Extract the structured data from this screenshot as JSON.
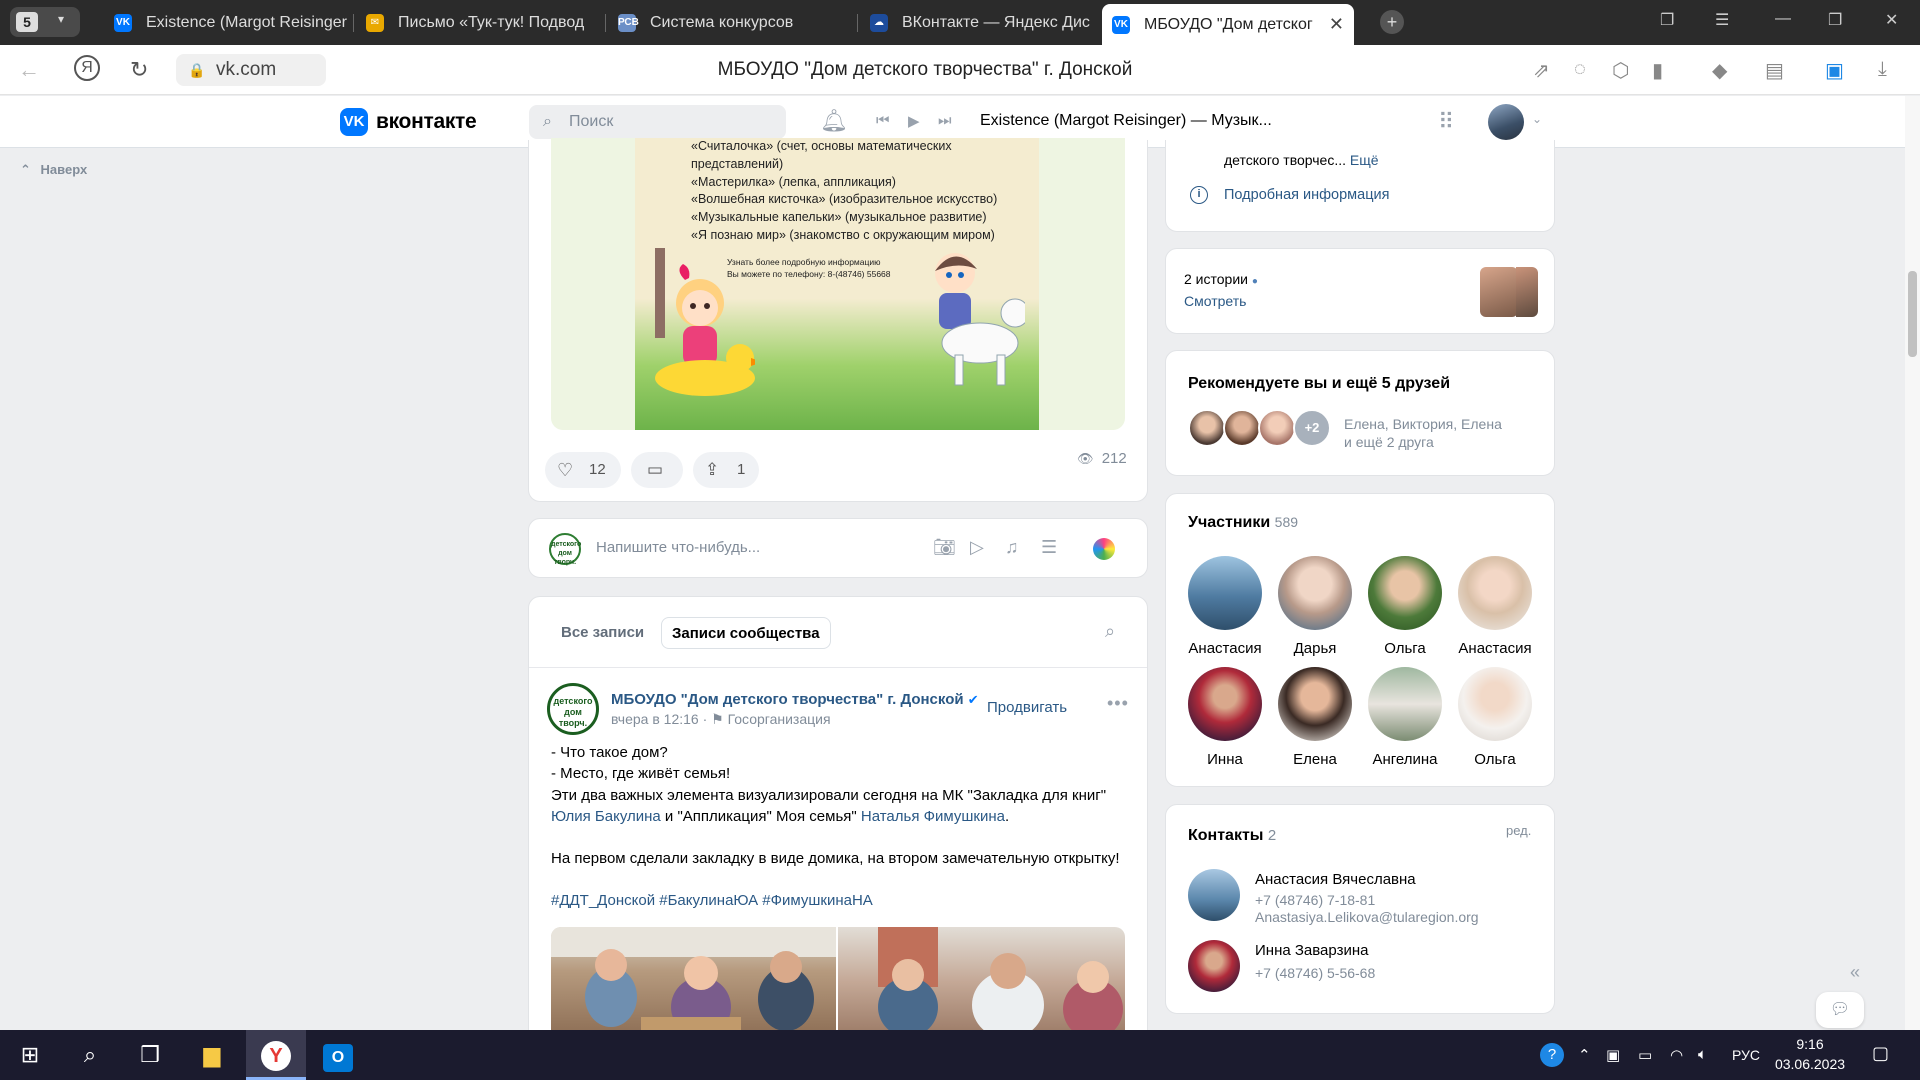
{
  "browser": {
    "tab_count": "5",
    "tabs": [
      {
        "title": "Existence (Margot Reisinger"
      },
      {
        "title": "Письмо «Тук-тук! Подвод"
      },
      {
        "title": "Система конкурсов"
      },
      {
        "title": "ВКонтакте — Яндекс Дис"
      },
      {
        "title": "МБОУДО \"Дом детског"
      }
    ],
    "url": "vk.com",
    "page_title": "МБОУДО \"Дом детского творчества\" г. Донской",
    "colors": {
      "chrome_bg": "#2b2b2b",
      "active_tab_bg": "#ffffff"
    }
  },
  "vk_header": {
    "logo_text": "вконтакте",
    "search_placeholder": "Поиск",
    "now_playing": "Existence (Margot Reisinger) — Музык..."
  },
  "sidebar": {
    "scroll_top_label": "Наверх"
  },
  "prev_post": {
    "poster_lines": [
      "«Считалочка» (счет, основы математических",
      "представлений)",
      "«Мастерилка» (лепка, аппликация)",
      "«Волшебная кисточка» (изобразительное искусство)",
      "«Музыкальные капельки» (музыкальное развитие)",
      "«Я познаю мир» (знакомство с окружающим миром)"
    ],
    "poster_small": [
      "Узнать более подробную информацию",
      "Вы можете по телефону: 8-(48746) 55668"
    ],
    "likes": "12",
    "shares": "1",
    "views": "212"
  },
  "composer": {
    "placeholder": "Напишите что-нибудь...",
    "avatar_text": "детского дом творч."
  },
  "wall": {
    "filters": [
      {
        "label": "Все записи",
        "active": false
      },
      {
        "label": "Записи сообщества",
        "active": true
      }
    ]
  },
  "post": {
    "avatar_text": "детского дом творч.",
    "author": "МБОУДО \"Дом детского творчества\" г. Донской",
    "time": "вчера в 12:16",
    "category": "Госорганизация",
    "promote_label": "Продвигать",
    "lines": [
      "- Что такое дом?",
      "- Место, где живёт семья!",
      "Эти два важных элемента визуализировали сегодня на МК \"Закладка для книг\""
    ],
    "mention1": "Юлия Бакулина",
    "mid_text": " и \"Аппликация\" Моя семья\" ",
    "mention2": "Наталья Фимушкина",
    "end_dot": ".",
    "line_after": "На первом сделали закладку в виде домика, на втором замечательную открытку!",
    "hashtags": "#ДДТ_Донской #БакулинаЮА #ФимушкинаНА"
  },
  "right": {
    "info_snippet": "детского творчес...",
    "info_more": "Ещё",
    "info_detail": "Подробная информация",
    "stories_label": "2 истории",
    "stories_watch": "Смотреть",
    "recommend_title": "Рекомендуете вы и ещё 5 друзей",
    "recommend_extra": "+2",
    "recommend_names": "Елена, Виктория, Елена",
    "recommend_more": "и ещё 2 друга",
    "members_title": "Участники",
    "members_count": "589",
    "members": [
      {
        "name": "Анастасия"
      },
      {
        "name": "Дарья"
      },
      {
        "name": "Ольга"
      },
      {
        "name": "Анастасия"
      },
      {
        "name": "Инна"
      },
      {
        "name": "Елена"
      },
      {
        "name": "Ангелина"
      },
      {
        "name": "Ольга"
      }
    ],
    "contacts_title": "Контакты",
    "contacts_count": "2",
    "contacts_edit": "ред.",
    "contacts": [
      {
        "name": "Анастасия Вячеславна",
        "phone": "+7 (48746) 7-18-81",
        "email": "Anastasiya.Lelikova@tularegion.org"
      },
      {
        "name": "Инна Заварзина",
        "phone": "+7 (48746) 5-56-68"
      }
    ]
  },
  "taskbar": {
    "lang": "РУС",
    "time": "9:16",
    "date": "03.06.2023"
  }
}
